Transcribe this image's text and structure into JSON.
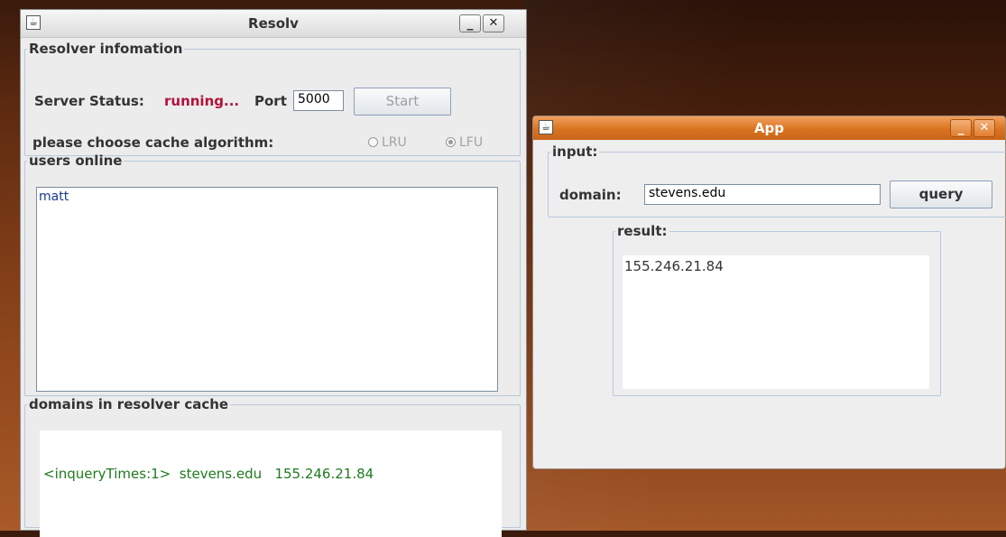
{
  "resolv": {
    "title": "Resolv",
    "minimize_glyph": "_",
    "close_glyph": "✕",
    "resolver_info": {
      "legend": "Resolver infomation",
      "status_label": "Server Status:",
      "status_value": "running...",
      "port_label": "Port",
      "port_value": "5000",
      "start_label": "Start",
      "cache_label": "please choose cache algorithm:",
      "options": [
        {
          "label": "LRU",
          "selected": false
        },
        {
          "label": "LFU",
          "selected": true
        }
      ]
    },
    "users_online": {
      "legend": "users online",
      "users": [
        "matt"
      ]
    },
    "cache": {
      "legend": "domains in resolver cache",
      "entries": [
        "<inqueryTimes:1>  stevens.edu   155.246.21.84"
      ]
    }
  },
  "app": {
    "title": "App",
    "input": {
      "legend": "input:",
      "domain_label": "domain:",
      "domain_value": "stevens.edu",
      "query_label": "query"
    },
    "result": {
      "legend": "result:",
      "value": "155.246.21.84"
    }
  },
  "colors": {
    "status_running": "#b3123a",
    "list_text": "#1a3b8c",
    "cache_text": "#1f7a1f",
    "app_titlebar": "#d9731f"
  }
}
